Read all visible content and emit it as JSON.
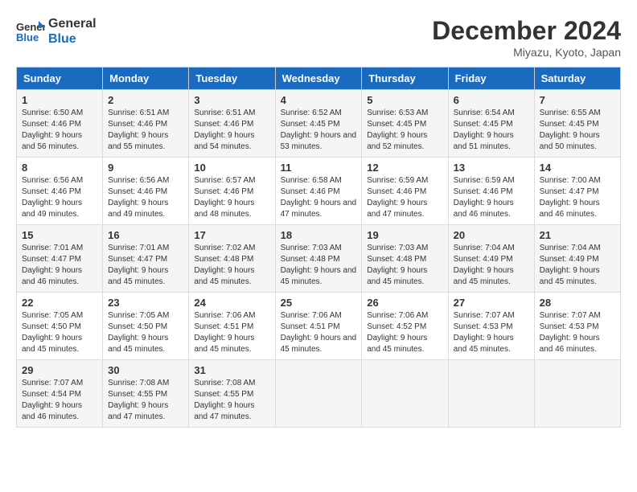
{
  "logo": {
    "line1": "General",
    "line2": "Blue"
  },
  "title": "December 2024",
  "location": "Miyazu, Kyoto, Japan",
  "weekdays": [
    "Sunday",
    "Monday",
    "Tuesday",
    "Wednesday",
    "Thursday",
    "Friday",
    "Saturday"
  ],
  "weeks": [
    [
      {
        "day": "1",
        "sunrise": "6:50 AM",
        "sunset": "4:46 PM",
        "daylight": "9 hours and 56 minutes."
      },
      {
        "day": "2",
        "sunrise": "6:51 AM",
        "sunset": "4:46 PM",
        "daylight": "9 hours and 55 minutes."
      },
      {
        "day": "3",
        "sunrise": "6:51 AM",
        "sunset": "4:46 PM",
        "daylight": "9 hours and 54 minutes."
      },
      {
        "day": "4",
        "sunrise": "6:52 AM",
        "sunset": "4:45 PM",
        "daylight": "9 hours and 53 minutes."
      },
      {
        "day": "5",
        "sunrise": "6:53 AM",
        "sunset": "4:45 PM",
        "daylight": "9 hours and 52 minutes."
      },
      {
        "day": "6",
        "sunrise": "6:54 AM",
        "sunset": "4:45 PM",
        "daylight": "9 hours and 51 minutes."
      },
      {
        "day": "7",
        "sunrise": "6:55 AM",
        "sunset": "4:45 PM",
        "daylight": "9 hours and 50 minutes."
      }
    ],
    [
      {
        "day": "8",
        "sunrise": "6:56 AM",
        "sunset": "4:46 PM",
        "daylight": "9 hours and 49 minutes."
      },
      {
        "day": "9",
        "sunrise": "6:56 AM",
        "sunset": "4:46 PM",
        "daylight": "9 hours and 49 minutes."
      },
      {
        "day": "10",
        "sunrise": "6:57 AM",
        "sunset": "4:46 PM",
        "daylight": "9 hours and 48 minutes."
      },
      {
        "day": "11",
        "sunrise": "6:58 AM",
        "sunset": "4:46 PM",
        "daylight": "9 hours and 47 minutes."
      },
      {
        "day": "12",
        "sunrise": "6:59 AM",
        "sunset": "4:46 PM",
        "daylight": "9 hours and 47 minutes."
      },
      {
        "day": "13",
        "sunrise": "6:59 AM",
        "sunset": "4:46 PM",
        "daylight": "9 hours and 46 minutes."
      },
      {
        "day": "14",
        "sunrise": "7:00 AM",
        "sunset": "4:47 PM",
        "daylight": "9 hours and 46 minutes."
      }
    ],
    [
      {
        "day": "15",
        "sunrise": "7:01 AM",
        "sunset": "4:47 PM",
        "daylight": "9 hours and 46 minutes."
      },
      {
        "day": "16",
        "sunrise": "7:01 AM",
        "sunset": "4:47 PM",
        "daylight": "9 hours and 45 minutes."
      },
      {
        "day": "17",
        "sunrise": "7:02 AM",
        "sunset": "4:48 PM",
        "daylight": "9 hours and 45 minutes."
      },
      {
        "day": "18",
        "sunrise": "7:03 AM",
        "sunset": "4:48 PM",
        "daylight": "9 hours and 45 minutes."
      },
      {
        "day": "19",
        "sunrise": "7:03 AM",
        "sunset": "4:48 PM",
        "daylight": "9 hours and 45 minutes."
      },
      {
        "day": "20",
        "sunrise": "7:04 AM",
        "sunset": "4:49 PM",
        "daylight": "9 hours and 45 minutes."
      },
      {
        "day": "21",
        "sunrise": "7:04 AM",
        "sunset": "4:49 PM",
        "daylight": "9 hours and 45 minutes."
      }
    ],
    [
      {
        "day": "22",
        "sunrise": "7:05 AM",
        "sunset": "4:50 PM",
        "daylight": "9 hours and 45 minutes."
      },
      {
        "day": "23",
        "sunrise": "7:05 AM",
        "sunset": "4:50 PM",
        "daylight": "9 hours and 45 minutes."
      },
      {
        "day": "24",
        "sunrise": "7:06 AM",
        "sunset": "4:51 PM",
        "daylight": "9 hours and 45 minutes."
      },
      {
        "day": "25",
        "sunrise": "7:06 AM",
        "sunset": "4:51 PM",
        "daylight": "9 hours and 45 minutes."
      },
      {
        "day": "26",
        "sunrise": "7:06 AM",
        "sunset": "4:52 PM",
        "daylight": "9 hours and 45 minutes."
      },
      {
        "day": "27",
        "sunrise": "7:07 AM",
        "sunset": "4:53 PM",
        "daylight": "9 hours and 45 minutes."
      },
      {
        "day": "28",
        "sunrise": "7:07 AM",
        "sunset": "4:53 PM",
        "daylight": "9 hours and 46 minutes."
      }
    ],
    [
      {
        "day": "29",
        "sunrise": "7:07 AM",
        "sunset": "4:54 PM",
        "daylight": "9 hours and 46 minutes."
      },
      {
        "day": "30",
        "sunrise": "7:08 AM",
        "sunset": "4:55 PM",
        "daylight": "9 hours and 47 minutes."
      },
      {
        "day": "31",
        "sunrise": "7:08 AM",
        "sunset": "4:55 PM",
        "daylight": "9 hours and 47 minutes."
      },
      null,
      null,
      null,
      null
    ]
  ]
}
